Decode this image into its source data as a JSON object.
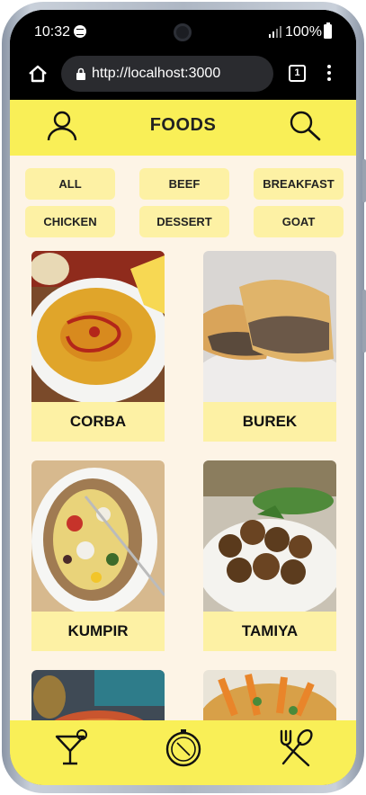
{
  "status_bar": {
    "time": "10:32",
    "battery": "100%"
  },
  "browser": {
    "url": "http://localhost:3000",
    "tab_count": "1"
  },
  "header": {
    "title": "FOODS"
  },
  "categories": [
    "ALL",
    "BEEF",
    "BREAKFAST",
    "CHICKEN",
    "DESSERT",
    "GOAT"
  ],
  "meals": [
    {
      "name": "CORBA"
    },
    {
      "name": "BUREK"
    },
    {
      "name": "KUMPIR"
    },
    {
      "name": "TAMIYA"
    }
  ],
  "icons": {
    "header_left": "user-icon",
    "header_right": "search-icon",
    "nav": [
      "cocktail-icon",
      "compass-icon",
      "utensils-icon"
    ]
  },
  "colors": {
    "accent": "#f9ef57",
    "chip": "#fdf1a4",
    "background": "#fdf4e6"
  }
}
